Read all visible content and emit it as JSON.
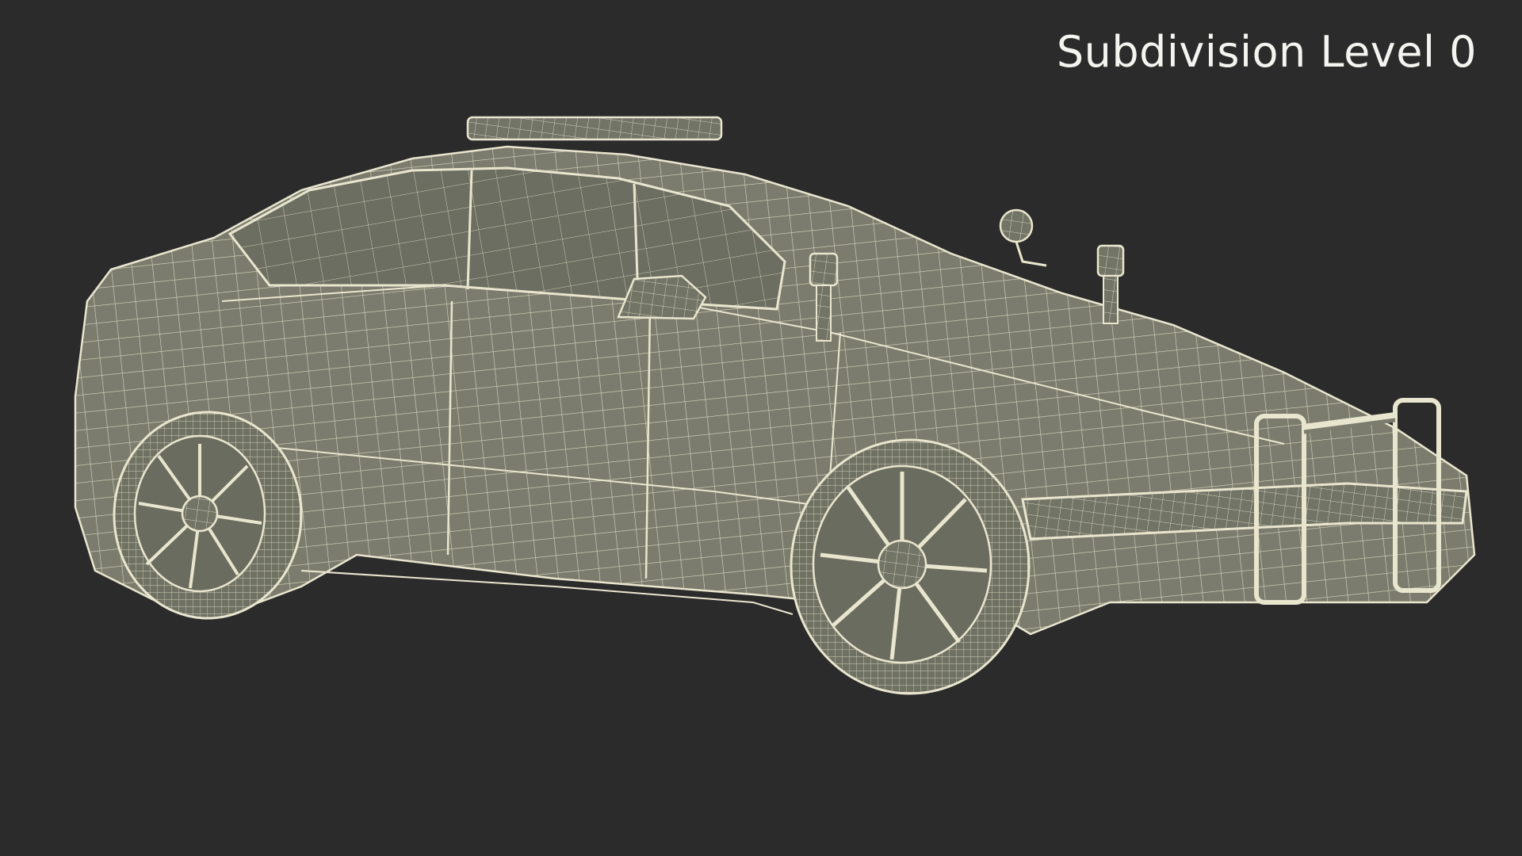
{
  "overlay": {
    "caption": "Subdivision Level 0"
  },
  "colors": {
    "background": "#2b2b2b",
    "surface": "#7b7c6d",
    "surface_dark": "#5e6053",
    "wire": "#e9e6cf",
    "caption": "#f4f4f0"
  }
}
